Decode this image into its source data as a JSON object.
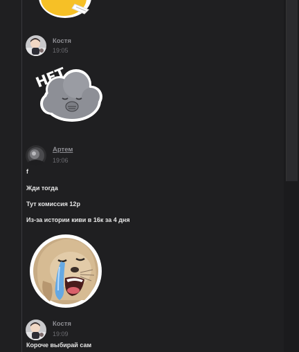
{
  "messages": [
    {
      "author": "Костя",
      "time": "19:05"
    },
    {
      "author": "Артем",
      "time": "19:06",
      "lines": [
        "f",
        "Жди тогда",
        "Тут комиссия 12р",
        "Из-за истории киви в 16к за 4 дня"
      ]
    },
    {
      "author": "Костя",
      "time": "19:09",
      "lines": [
        "Короче выбирай сам"
      ]
    }
  ],
  "stickers": {
    "cloud_text": "НЕТ",
    "top_partial": "sticker-partial",
    "cloud": "cloud-no-sticker",
    "seal": "crying-seal-sticker"
  },
  "colors": {
    "background": "#1f1f21",
    "author": "#8e8e93",
    "time": "#6e6e73",
    "text": "#e6e6e6"
  }
}
